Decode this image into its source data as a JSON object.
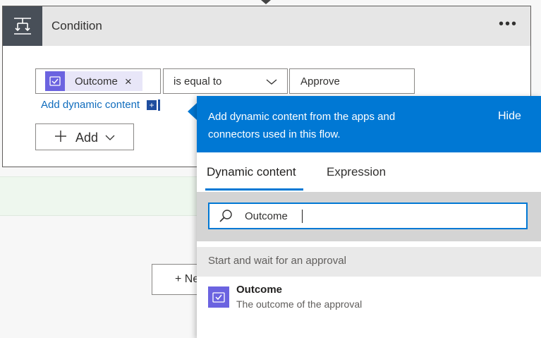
{
  "condition_card": {
    "title": "Condition",
    "more_icon": "ellipsis-icon",
    "header_icon": "condition-icon",
    "token_label": "Outcome",
    "token_remove": "×",
    "operator": "is equal to",
    "value": "Approve",
    "add_dynamic_content": "Add dynamic content",
    "add_dynamic_plus": "+",
    "add_button": "Add"
  },
  "background": {
    "new_step_button": "+ Ne"
  },
  "dynamic_panel": {
    "banner_text": "Add dynamic content from the apps and connectors used in this flow.",
    "hide_label": "Hide",
    "tabs": [
      {
        "label": "Dynamic content",
        "active": true
      },
      {
        "label": "Expression",
        "active": false
      }
    ],
    "search_value": "Outcome",
    "section_title": "Start and wait for an approval",
    "results": [
      {
        "title": "Outcome",
        "description": "The outcome of the approval",
        "icon": "approval-icon"
      }
    ]
  },
  "colors": {
    "accent": "#0078d4",
    "approval": "#6b63e0",
    "header_icon_bg": "#484f58"
  }
}
